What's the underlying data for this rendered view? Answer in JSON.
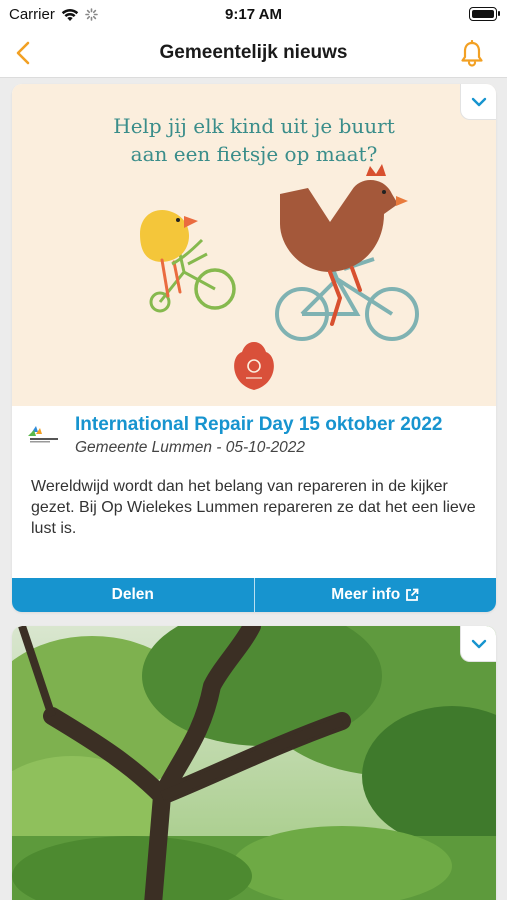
{
  "status_bar": {
    "carrier": "Carrier",
    "time": "9:17 AM"
  },
  "nav": {
    "title": "Gemeentelijk nieuws",
    "icons": [
      "chevron-left-icon",
      "bell-icon"
    ],
    "accent": "#F2A023"
  },
  "posts": [
    {
      "hero_text_line1": "Help jij elk kind uit je buurt",
      "hero_text_line2": "aan een fietsje op maat?",
      "title": "International Repair Day 15 oktober 2022",
      "subtitle": "Gemeente Lummen - 05-10-2022",
      "body": "Wereldwijd wordt dan het belang van repareren in de kijker gezet. Bij Op Wielekes Lummen repareren ze dat het een lieve lust is.",
      "share_label": "Delen",
      "more_label": "Meer info"
    },
    {
      "image": "garden-photo"
    }
  ],
  "colors": {
    "brand_blue": "#1794CF",
    "hero_bg": "#FBEEDD",
    "hero_text": "#3A8D8A"
  }
}
